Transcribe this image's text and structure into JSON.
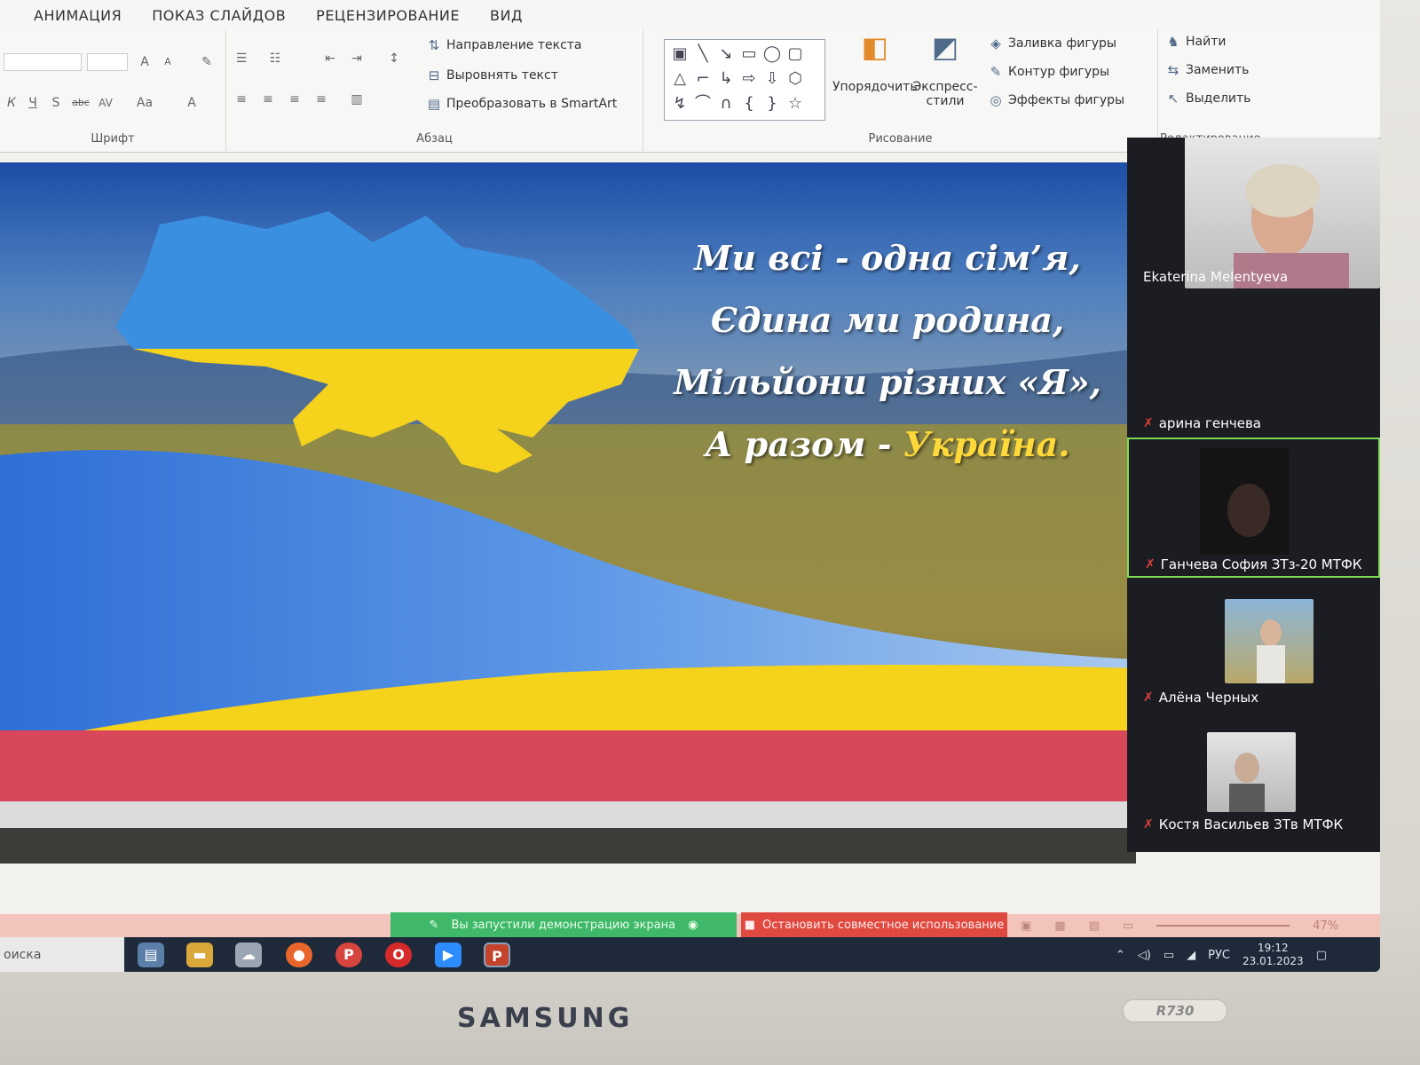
{
  "menu": {
    "items": [
      "АНИМАЦИЯ",
      "ПОКАЗ СЛАЙДОВ",
      "РЕЦЕНЗИРОВАНИЕ",
      "ВИД"
    ]
  },
  "ribbon": {
    "font_group_label": "Шрифт",
    "paragraph_group_label": "Абзац",
    "drawing_group_label": "Рисование",
    "editing_group_label": "Редактирование",
    "text_direction": "Направление текста",
    "align_text": "Выровнять текст",
    "convert_smartart": "Преобразовать в SmartArt",
    "arrange": "Упорядочить",
    "quick_styles": "Экспресс-стили",
    "shape_fill": "Заливка фигуры",
    "shape_outline": "Контур фигуры",
    "shape_effects": "Эффекты фигуры",
    "find": "Найти",
    "replace": "Заменить",
    "select": "Выделить",
    "font_size_buttons": [
      "A",
      "A",
      "Aa"
    ]
  },
  "slide": {
    "lines": [
      "Ми всі - одна сім’я,",
      "Єдина ми родина,",
      "Мільйони різних «Я»,"
    ],
    "last_line_prefix": "А разом - ",
    "last_line_highlight": "Україна."
  },
  "participants": [
    {
      "name": "Ekaterina Melentyeva",
      "video": true,
      "muted": false
    },
    {
      "name": "арина генчева",
      "video": false,
      "muted": true
    },
    {
      "name": "Ганчева София ЗТз-20 МТФК",
      "video": true,
      "muted": true,
      "active": true
    },
    {
      "name": "Алёна Черных",
      "video": true,
      "muted": true
    },
    {
      "name": "Костя Васильев ЗТв МТФК",
      "video": true,
      "muted": true
    }
  ],
  "sharebar": {
    "status": "Вы запустили демонстрацию экрана",
    "stop": "Остановить совместное использование",
    "zoom": "47%"
  },
  "taskbar": {
    "search": "оиска",
    "language": "РУС",
    "time": "19:12",
    "date": "23.01.2023",
    "apps": [
      "explorer",
      "files",
      "cloud",
      "firefox",
      "P",
      "opera",
      "zoom",
      "P"
    ]
  },
  "device": {
    "brand": "SAMSUNG",
    "model": "R730"
  },
  "colors": {
    "ukraine_blue": "#2f6fd6",
    "ukraine_yellow": "#f5d21c",
    "share_green": "#3fb86a",
    "share_red": "#e0493f"
  }
}
